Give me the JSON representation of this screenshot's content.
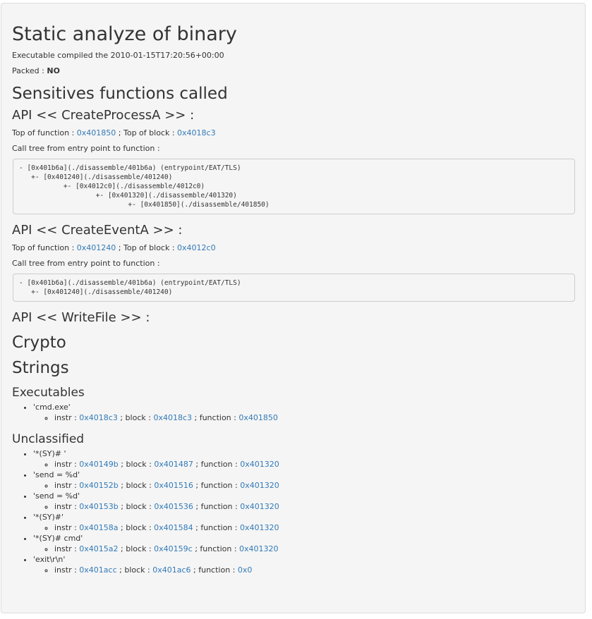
{
  "title": "Static analyze of binary",
  "compiled_text": "Executable compiled the 2010-01-15T17:20:56+00:00",
  "packed_label": "Packed : ",
  "packed_value": "NO",
  "sensitive_heading": "Sensitives functions called",
  "api_sections": [
    {
      "heading": "API << CreateProcessA >> :",
      "top_fn_label": "Top of function : ",
      "top_fn_addr": "0x401850",
      "top_block_label": " ; Top of block : ",
      "top_block_addr": "0x4018c3",
      "calltree_label": "Call tree from entry point to function :",
      "calltree": "- [0x401b6a](./disassemble/401b6a) (entrypoint/EAT/TLS)\n   +- [0x401240](./disassemble/401240)\n           +- [0x4012c0](./disassemble/4012c0)\n                   +- [0x401320](./disassemble/401320)\n                           +- [0x401850](./disassemble/401850)"
    },
    {
      "heading": "API << CreateEventA >> :",
      "top_fn_label": "Top of function : ",
      "top_fn_addr": "0x401240",
      "top_block_label": " ; Top of block : ",
      "top_block_addr": "0x4012c0",
      "calltree_label": "Call tree from entry point to function :",
      "calltree": "- [0x401b6a](./disassemble/401b6a) (entrypoint/EAT/TLS)\n   +- [0x401240](./disassemble/401240)"
    },
    {
      "heading": "API << WriteFile >> :"
    }
  ],
  "crypto_heading": "Crypto",
  "strings_heading": "Strings",
  "labels": {
    "instr": "instr : ",
    "block": " ; block : ",
    "function": " ; function : "
  },
  "executables": {
    "heading": "Executables",
    "items": [
      {
        "value": "'cmd.exe'",
        "instr": "0x4018c3",
        "block": "0x4018c3",
        "function": "0x401850"
      }
    ]
  },
  "unclassified": {
    "heading": "Unclassified",
    "items": [
      {
        "value": "'*(SY)# '",
        "instr": "0x40149b",
        "block": "0x401487",
        "function": "0x401320"
      },
      {
        "value": "'send = %d'",
        "instr": "0x40152b",
        "block": "0x401516",
        "function": "0x401320"
      },
      {
        "value": "'send = %d'",
        "instr": "0x40153b",
        "block": "0x401536",
        "function": "0x401320"
      },
      {
        "value": "'*(SY)#'",
        "instr": "0x40158a",
        "block": "0x401584",
        "function": "0x401320"
      },
      {
        "value": "'*(SY)# cmd'",
        "instr": "0x4015a2",
        "block": "0x40159c",
        "function": "0x401320"
      },
      {
        "value": "'exit\\r\\n'",
        "instr": "0x401acc",
        "block": "0x401ac6",
        "function": "0x0"
      }
    ]
  },
  "colors": {
    "link": "#337ab7",
    "panel_bg": "#f5f5f5",
    "text": "#333333"
  }
}
